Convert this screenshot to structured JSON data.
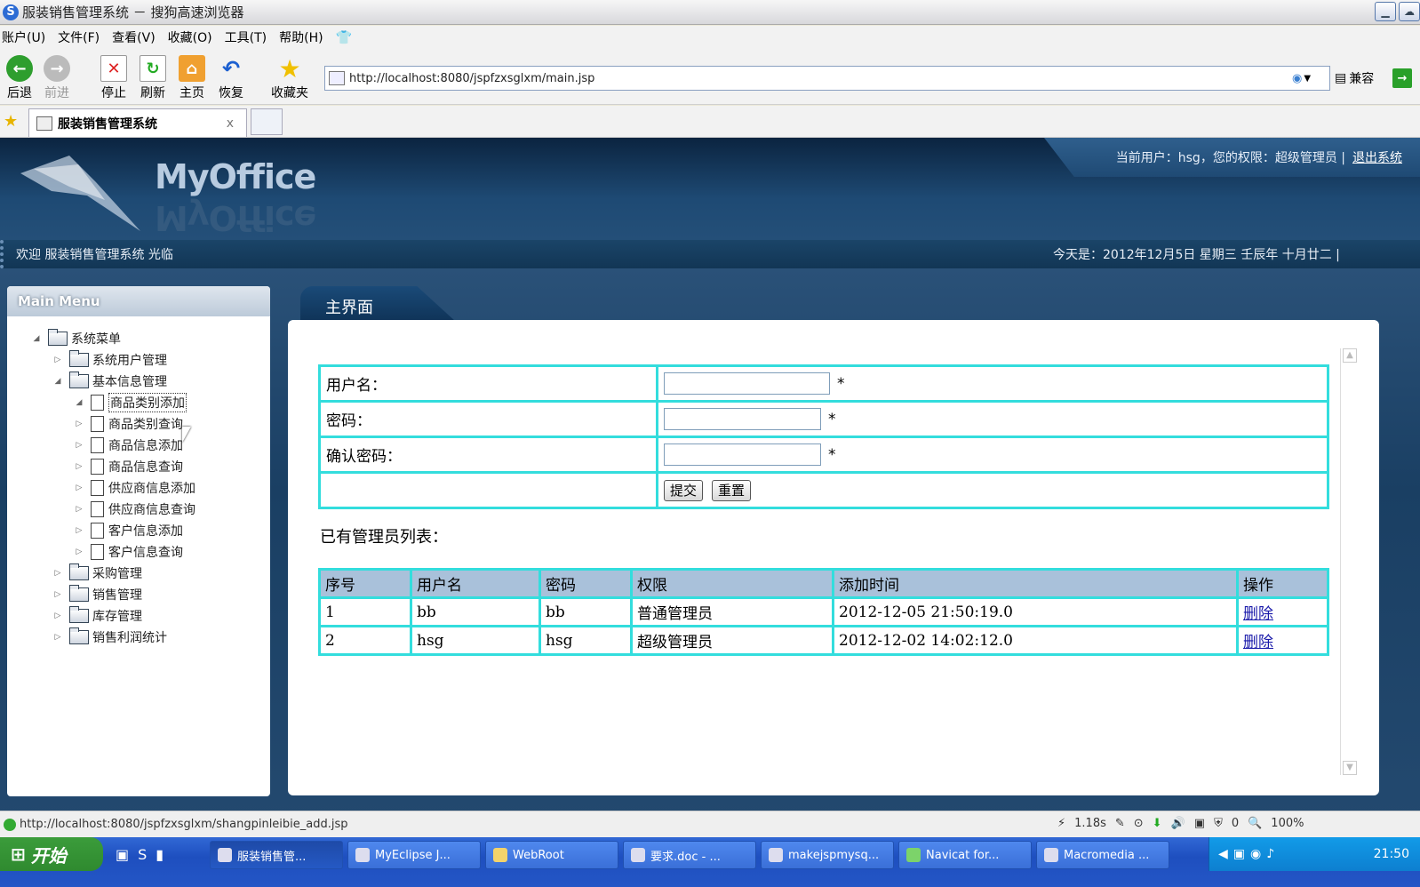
{
  "window": {
    "title": "服装销售管理系统 － 搜狗高速浏览器",
    "logo_letter": "S"
  },
  "menubar": [
    "账户(U)",
    "文件(F)",
    "查看(V)",
    "收藏(O)",
    "工具(T)",
    "帮助(H)"
  ],
  "toolbar": {
    "back": "后退",
    "forward": "前进",
    "stop": "停止",
    "refresh": "刷新",
    "home": "主页",
    "restore": "恢复",
    "favorites": "收藏夹",
    "compat": "兼容"
  },
  "address": {
    "url": "http://localhost:8080/jspfzxsglxm/main.jsp"
  },
  "tab": {
    "title": "服装销售管理系统",
    "close": "x"
  },
  "header": {
    "logo": "MyOffice",
    "user_info": "当前用户：hsg，您的权限：超级管理员 |",
    "logout": "退出系统",
    "welcome": "欢迎 服装销售管理系统 光临",
    "today": "今天是：2012年12月5日 星期三 壬辰年 十月廿二 |"
  },
  "sidebar": {
    "title": "Main Menu",
    "root": "系统菜单",
    "items": [
      "系统用户管理",
      "基本信息管理",
      "商品类别添加",
      "商品类别查询",
      "商品信息添加",
      "商品信息查询",
      "供应商信息添加",
      "供应商信息查询",
      "客户信息添加",
      "客户信息查询",
      "采购管理",
      "销售管理",
      "库存管理",
      "销售利润统计"
    ]
  },
  "main": {
    "tab": "主界面",
    "form": {
      "username_label": "用户名：",
      "password_label": "密码：",
      "confirm_label": "确认密码：",
      "required": "*",
      "submit": "提交",
      "reset": "重置"
    },
    "list_title": "已有管理员列表：",
    "table": {
      "headers": [
        "序号",
        "用户名",
        "密码",
        "权限",
        "添加时间",
        "操作"
      ],
      "rows": [
        [
          "1",
          "bb",
          "bb",
          "普通管理员",
          "2012-12-05 21:50:19.0",
          "删除"
        ],
        [
          "2",
          "hsg",
          "hsg",
          "超级管理员",
          "2012-12-02 14:02:12.0",
          "删除"
        ]
      ]
    }
  },
  "status": {
    "url": "http://localhost:8080/jspfzxsglxm/shangpinleibie_add.jsp",
    "time": "1.18s",
    "count": "0",
    "zoom": "100%"
  },
  "taskbar": {
    "start": "开始",
    "tasks": [
      "服装销售管...",
      "MyEclipse J...",
      "WebRoot",
      "要求.doc - ...",
      "makejspmysq...",
      "Navicat for...",
      "Macromedia ..."
    ],
    "clock": "21:50"
  }
}
